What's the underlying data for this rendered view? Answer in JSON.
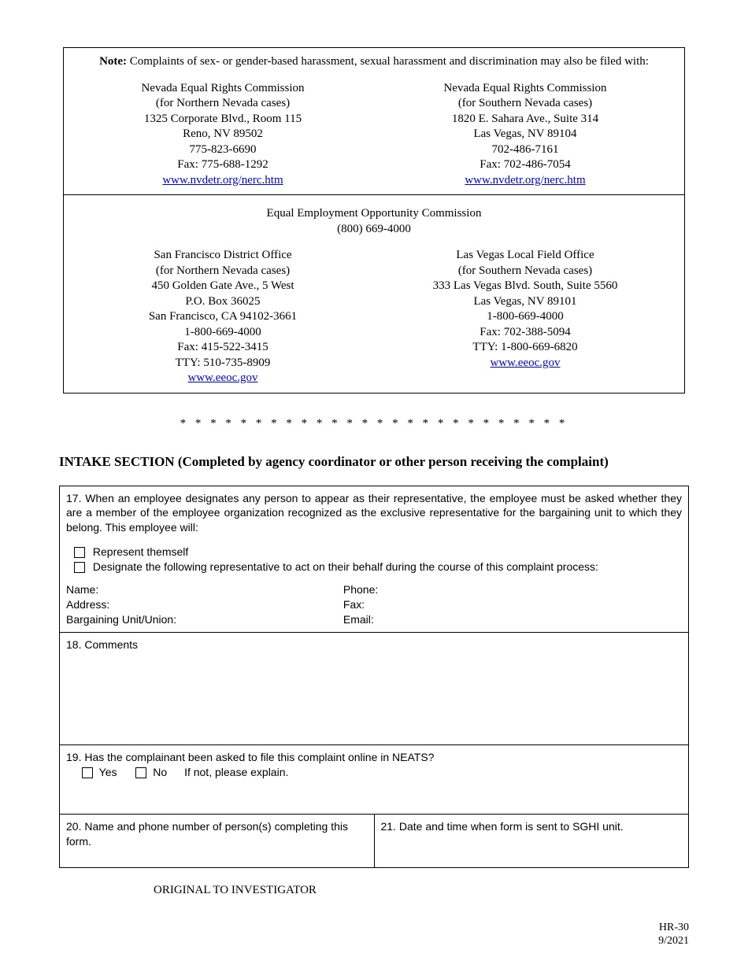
{
  "note": {
    "label": "Note:",
    "text": "Complaints of sex- or gender-based harassment, sexual harassment and discrimination may also be filed with:",
    "nerc_left": {
      "name": "Nevada Equal Rights Commission",
      "region": "(for Northern Nevada cases)",
      "addr1": "1325 Corporate Blvd., Room 115",
      "addr2": "Reno, NV 89502",
      "phone": "775-823-6690",
      "fax": "Fax: 775-688-1292",
      "url": "www.nvdetr.org/nerc.htm"
    },
    "nerc_right": {
      "name": "Nevada Equal Rights Commission",
      "region": "(for Southern Nevada cases)",
      "addr1": "1820 E. Sahara Ave., Suite 314",
      "addr2": "Las Vegas, NV 89104",
      "phone": "702-486-7161",
      "fax": "Fax: 702-486-7054",
      "url": "www.nvdetr.org/nerc.htm"
    },
    "eeoc_header": "Equal Employment Opportunity Commission",
    "eeoc_phone": "(800) 669-4000",
    "eeoc_left": {
      "name": "San Francisco District Office",
      "region": "(for Northern Nevada cases)",
      "addr1": "450 Golden Gate Ave., 5 West",
      "addr2": "P.O. Box 36025",
      "addr3": "San Francisco, CA 94102-3661",
      "phone": "1-800-669-4000",
      "fax": "Fax: 415-522-3415",
      "tty": "TTY: 510-735-8909",
      "url": "www.eeoc.gov"
    },
    "eeoc_right": {
      "name": "Las Vegas Local Field Office",
      "region": "(for Southern Nevada cases)",
      "addr1": "333 Las Vegas Blvd. South, Suite 5560",
      "addr2": "Las Vegas, NV 89101",
      "phone": "1-800-669-4000",
      "fax": "Fax: 702-388-5094",
      "tty": "TTY: 1-800-669-6820",
      "url": "www.eeoc.gov"
    }
  },
  "stars": "* * * * * * * * * * * * * * * * * * * * * * * * * *",
  "intake_heading": "INTAKE SECTION (Completed by agency coordinator or other person receiving the complaint)",
  "q17": {
    "text": "17.  When an employee designates any person to appear as their representative, the employee must be asked whether they are a member of the employee organization recognized as the exclusive representative for the bargaining unit to which they belong.  This employee will:",
    "opt1": "Represent themself",
    "opt2": "Designate the following representative to act on their behalf during the course of this complaint process:",
    "name": "Name:",
    "address": "Address:",
    "bargaining": "Bargaining Unit/Union:",
    "phone": "Phone:",
    "fax": "Fax:",
    "email": "Email:"
  },
  "q18": "18.  Comments",
  "q19": {
    "text": "19. Has the complainant been asked to file this complaint online in NEATS?",
    "yes": "Yes",
    "no": "No",
    "ifnot": "If not, please explain."
  },
  "q20": "20. Name and phone number of person(s) completing this form.",
  "q21": "21.  Date and time when form is sent to SGHI unit.",
  "original": "ORIGINAL TO INVESTIGATOR",
  "footer": {
    "form": "HR-30",
    "date": "9/2021"
  }
}
